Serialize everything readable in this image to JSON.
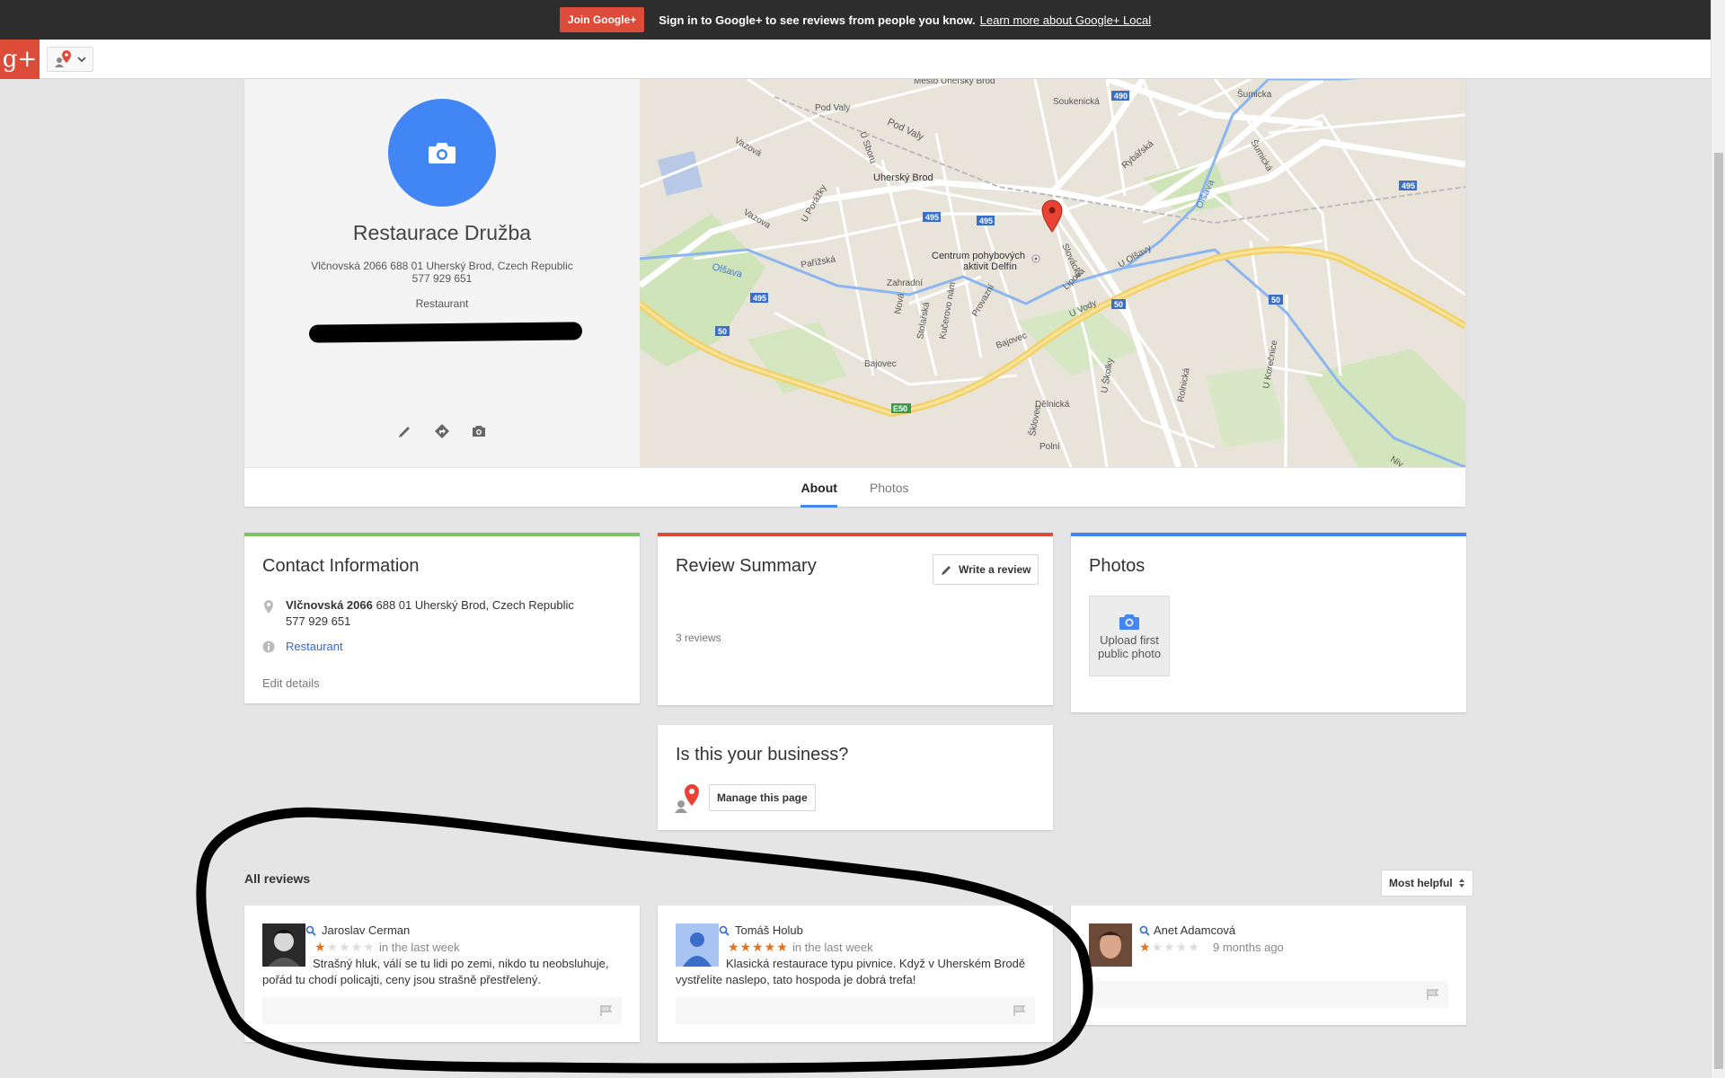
{
  "promo_bar": {
    "join_label": "Join Google+",
    "message": "Sign in to Google+ to see reviews from people you know.",
    "learn_more": "Learn more about Google+ Local"
  },
  "nav": {
    "logo": "g+",
    "local_icon": "local-places-icon"
  },
  "place": {
    "name": "Restaurace Družba",
    "address": "Vlčnovská 2066 688 01 Uherský Brod, Czech Republic",
    "phone": "577 929 651",
    "category": "Restaurant"
  },
  "map": {
    "labels": {
      "mesto": "Mesto Uhersky Brod",
      "soukenicka": "Soukenická",
      "sumicka": "Šumicka",
      "sumicka2": "Šumická",
      "podvaly": "Pod Valy",
      "podvaly2": "Pod Valy",
      "vazova": "Vazová",
      "vazova2": "Vazova",
      "uherskybrod": "Uherský Brod",
      "centrum1": "Centrum pohybových",
      "centrum2": "aktivit Delfín",
      "olsava": "Olšava",
      "olsava2": "Olšava",
      "parizska": "Pařížská",
      "zahradni": "Zahradní",
      "bajovec": "Bajovec",
      "bajovec2": "Bajovec",
      "slovacka": "Slovácká",
      "lipova": "Lipová",
      "uvody": "U Vody",
      "uolsavy": "U Olšavy",
      "rybarska": "Rybářská",
      "delnicka": "Dělnická",
      "uskolky": "U Školky",
      "polni": "Polní",
      "sklovec": "Šklovec",
      "rolnicka": "Rolnická",
      "ukorecnice": "U Korečnice",
      "nivnice": "Niv",
      "stolarska": "Stolařská",
      "nova": "Nová",
      "provazni": "Provazní",
      "kucerovo": "Kučerovo nám",
      "uporazky": "U Porážky",
      "ubrodu": "U Sboru"
    },
    "shields": {
      "r495": "495",
      "r490": "490",
      "r50": "50",
      "e50": "E50"
    }
  },
  "tabs": [
    "About",
    "Photos"
  ],
  "contact_card": {
    "title": "Contact Information",
    "street": "Vlčnovská 2066",
    "address_rest": "688 01 Uherský Brod, Czech Republic",
    "phone": "577 929 651",
    "category": "Restaurant",
    "edit_label": "Edit details"
  },
  "review_summary": {
    "title": "Review Summary",
    "write_label": "Write a review",
    "count_text": "3 reviews"
  },
  "photos_card": {
    "title": "Photos",
    "upload_label": "Upload first public photo"
  },
  "business_card": {
    "title": "Is this your business?",
    "manage_label": "Manage this page"
  },
  "reviews_section": {
    "title": "All reviews",
    "sort_label": "Most helpful"
  },
  "reviews": [
    {
      "author": "Jaroslav Cerman",
      "rating": 1,
      "time": "in the last week",
      "text": "Strašný hluk, válí se tu lidi po zemi, nikdo tu neobsluhuje, pořád tu chodí policajti, ceny jsou strašně přestřelený."
    },
    {
      "author": "Tomáš Holub",
      "rating": 5,
      "time": "in the last week",
      "text": "Klasická restaurace typu pivnice. Když v Uherském Brodě vystřelíte naslepo, tato hospoda je dobrá trefa!"
    },
    {
      "author": "Anet Adamcová",
      "rating": 1,
      "time": "9 months ago",
      "text": ""
    }
  ],
  "colors": {
    "brand_red": "#dd4b39",
    "accent_blue": "#4285f4",
    "contact_green": "#7ac36b",
    "star_orange": "#e7711b"
  }
}
